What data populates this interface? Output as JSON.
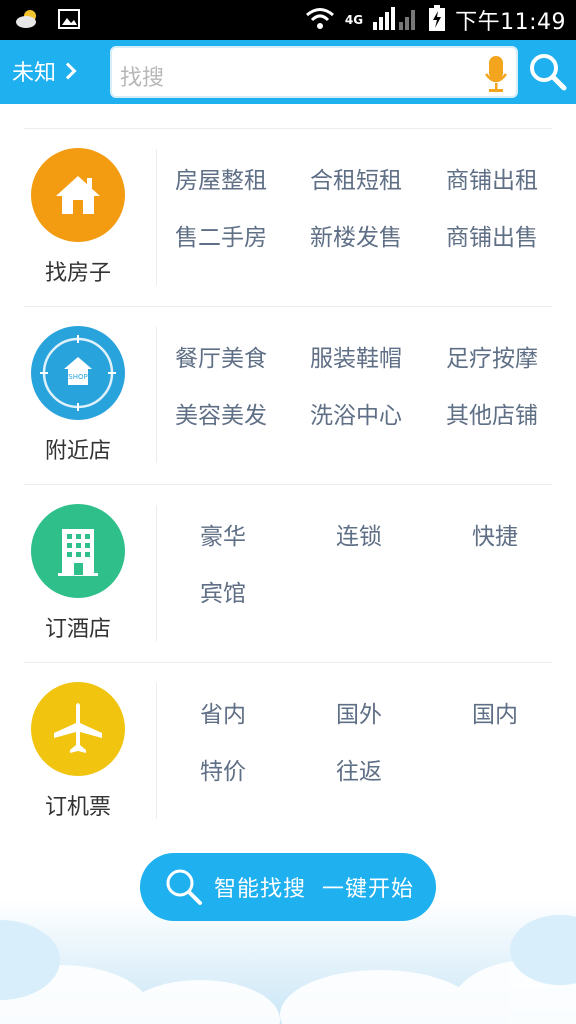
{
  "status_bar": {
    "time": "下午11:49",
    "network": "4G",
    "icons": [
      "weather-cloud-icon",
      "image-icon",
      "wifi-icon",
      "signal-icon",
      "battery-charging-icon"
    ]
  },
  "header": {
    "location": "未知",
    "search_placeholder": "找搜",
    "accent_color": "#1eb0ef"
  },
  "categories": [
    {
      "label": "找房子",
      "icon": "house-icon",
      "color": "#f39c12",
      "links": [
        "房屋整租",
        "合租短租",
        "商铺出租",
        "售二手房",
        "新楼发售",
        "商铺出售"
      ]
    },
    {
      "label": "附近店",
      "icon": "shop-target-icon",
      "color": "#29a3dc",
      "links": [
        "餐厅美食",
        "服装鞋帽",
        "足疗按摩",
        "美容美发",
        "洗浴中心",
        "其他店铺"
      ]
    },
    {
      "label": "订酒店",
      "icon": "building-icon",
      "color": "#2ebf8a",
      "links": [
        "豪华",
        "连锁",
        "快捷",
        "宾馆"
      ]
    },
    {
      "label": "订机票",
      "icon": "airplane-icon",
      "color": "#f1c40f",
      "links": [
        "省内",
        "国外",
        "国内",
        "特价",
        "往返"
      ]
    }
  ],
  "smart_search": {
    "label": "智能找搜  一键开始",
    "icon": "search-icon"
  }
}
